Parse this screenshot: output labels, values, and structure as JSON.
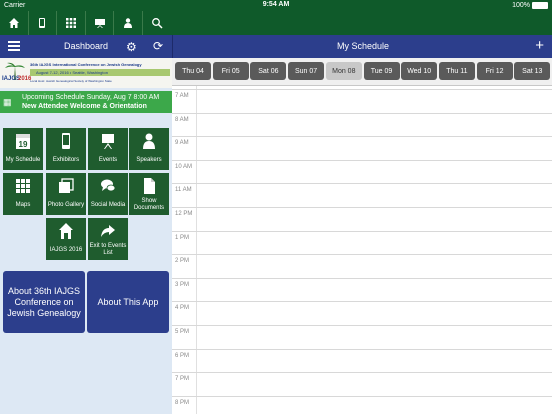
{
  "status_bar": {
    "carrier": "Carrier",
    "time": "9:54 AM",
    "battery": "100%"
  },
  "nav_icons": [
    "home-icon",
    "phone-icon",
    "grid-icon",
    "easel-icon",
    "person-icon",
    "search-icon"
  ],
  "dashboard": {
    "title": "Dashboard"
  },
  "banner": {
    "logo_text": "IAJGS",
    "logo_year": "2016",
    "line1": "36th IAJGS International Conference on Jewish Genealogy",
    "line2": "August 7-12, 2016 • Seattle, Washington",
    "line3": "Local Host: Jewish Genealogical Society of Washington State"
  },
  "upcoming": {
    "line1": "Upcoming Schedule Sunday, Aug 7 8:00 AM",
    "line2": "New Attendee Welcome & Orientation"
  },
  "tiles": [
    {
      "label": "My Schedule",
      "icon": "calendar-icon"
    },
    {
      "label": "Exhibitors",
      "icon": "phone-icon"
    },
    {
      "label": "Events",
      "icon": "easel-icon"
    },
    {
      "label": "Speakers",
      "icon": "person-icon"
    },
    {
      "label": "Maps",
      "icon": "grid-icon"
    },
    {
      "label": "Photo Gallery",
      "icon": "gallery-icon"
    },
    {
      "label": "Social Media",
      "icon": "chat-icon"
    },
    {
      "label": "Show Documents",
      "icon": "document-icon"
    },
    {
      "label": "IAJGS 2016",
      "icon": "house-icon"
    },
    {
      "label": "Exit to Events List",
      "icon": "share-icon"
    }
  ],
  "big_buttons": [
    {
      "label": "About 36th IAJGS Conference on Jewish Genealogy"
    },
    {
      "label": "About This App"
    }
  ],
  "schedule": {
    "title": "My Schedule",
    "add_label": "+",
    "days": [
      "Thu 04",
      "Fri 05",
      "Sat 06",
      "Sun 07",
      "Mon 08",
      "Tue 09",
      "Wed 10",
      "Thu 11",
      "Fri 12",
      "Sat 13"
    ],
    "selected_day": "Mon 08",
    "hours": [
      "7 AM",
      "8 AM",
      "9 AM",
      "10 AM",
      "11 AM",
      "12 PM",
      "1 PM",
      "2 PM",
      "3 PM",
      "4 PM",
      "5 PM",
      "6 PM",
      "7 PM",
      "8 PM"
    ]
  },
  "colors": {
    "green_dark": "#1f5c2e",
    "green_bar": "#0f5a2a",
    "green_upcoming": "#3ca84a",
    "blue_header": "#2c3e8c",
    "panel_bg": "#dde8f4"
  }
}
